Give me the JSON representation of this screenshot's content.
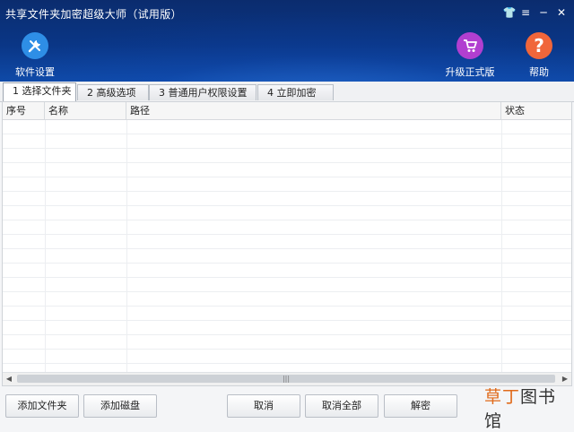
{
  "window": {
    "title": "共享文件夹加密超级大师（试用版）"
  },
  "window_controls": {
    "skin": "👕",
    "menu": "≡",
    "minimize": "─",
    "close": "✕"
  },
  "toolbar": {
    "settings_label": "软件设置",
    "upgrade_label": "升级正式版",
    "help_label": "帮助",
    "settings_color": "#2e8ee6",
    "upgrade_color": "#b13fd0",
    "help_color": "#f0663a"
  },
  "tabs": [
    {
      "label": "1 选择文件夹",
      "active": true
    },
    {
      "label": "2 高级选项",
      "active": false
    },
    {
      "label": "3 普通用户权限设置",
      "active": false
    },
    {
      "label": "4 立即加密",
      "active": false
    }
  ],
  "table": {
    "columns": [
      "序号",
      "名称",
      "路径",
      "状态"
    ],
    "rows": []
  },
  "buttons": {
    "add_folder": "添加文件夹",
    "add_disk": "添加磁盘",
    "cancel": "取消",
    "cancel_all": "取消全部",
    "decrypt": "解密"
  },
  "watermark": {
    "part1": "草丁",
    "part2": "图书馆"
  }
}
